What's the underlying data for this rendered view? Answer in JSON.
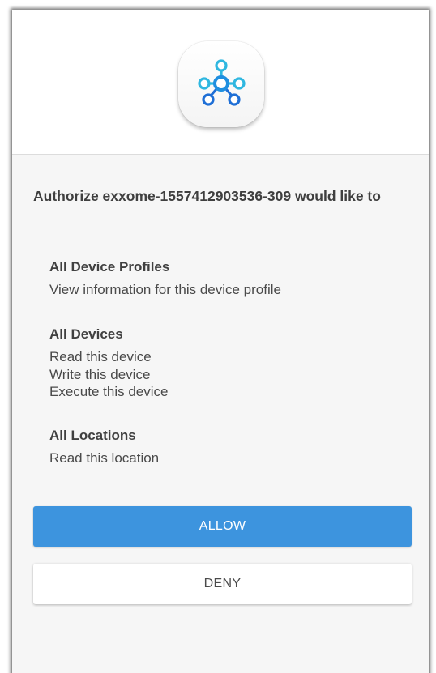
{
  "colors": {
    "allow_button": "#3d94de",
    "icon_light_blue": "#2fb7e0",
    "icon_dark_blue": "#1f6fd6"
  },
  "header": {
    "icon": "connected-hub-icon"
  },
  "prompt": {
    "title": "Authorize exxome-1557412903536-309 would like to"
  },
  "permissions": [
    {
      "title": "All Device Profiles",
      "items": [
        "View information for this device profile"
      ]
    },
    {
      "title": "All Devices",
      "items": [
        "Read this device",
        "Write this device",
        "Execute this device"
      ]
    },
    {
      "title": "All Locations",
      "items": [
        "Read this location"
      ]
    }
  ],
  "actions": {
    "allow_label": "ALLOW",
    "deny_label": "DENY"
  }
}
